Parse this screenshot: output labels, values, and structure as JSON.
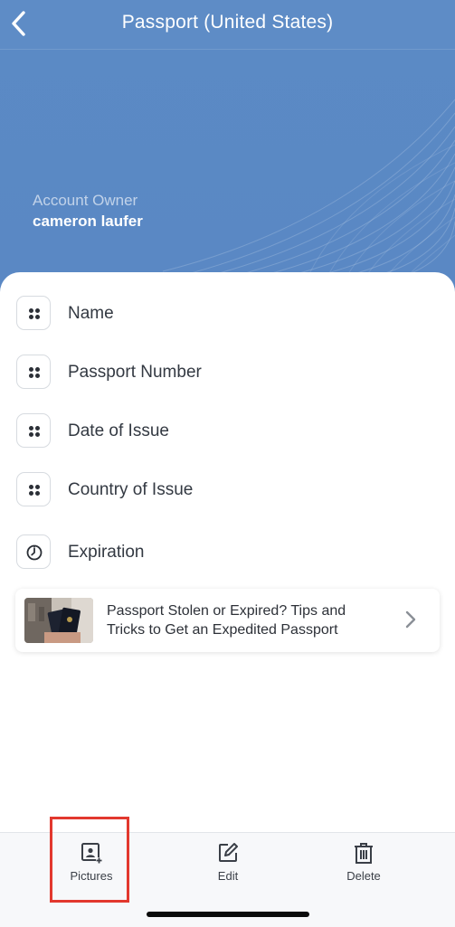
{
  "header": {
    "title": "Passport (United States)",
    "owner_label": "Account Owner",
    "owner_name": "cameron laufer",
    "accent_color": "#5a88c4"
  },
  "fields": [
    {
      "label": "Name",
      "icon": "dots-icon"
    },
    {
      "label": "Passport Number",
      "icon": "dots-icon"
    },
    {
      "label": "Date of Issue",
      "icon": "dots-icon"
    },
    {
      "label": "Country of Issue",
      "icon": "dots-icon"
    },
    {
      "label": "Expiration",
      "icon": "clock-icon"
    }
  ],
  "article": {
    "text": "Passport Stolen or Expired? Tips and Tricks to Get an Expedited Passport",
    "icon": "chevron-right-icon"
  },
  "tabbar": {
    "pictures": "Pictures",
    "edit": "Edit",
    "delete": "Delete"
  },
  "highlight_color": "#e2382e"
}
